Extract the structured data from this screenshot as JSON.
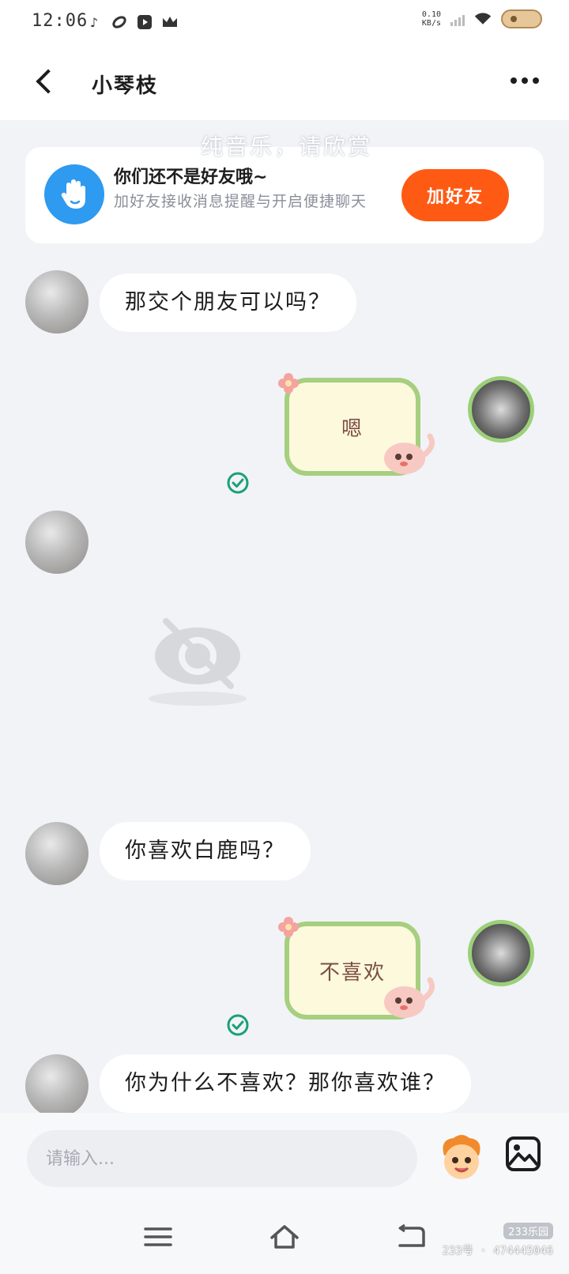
{
  "status_bar": {
    "time": "12:06",
    "net_speed_value": "0.10",
    "net_speed_unit": "KB/s"
  },
  "header": {
    "title": "小琴枝"
  },
  "watermark_top": "纯音乐，请欣赏",
  "friend_card": {
    "title": "你们还不是好友哦~",
    "subtitle": "加好友接收消息提醒与开启便捷聊天",
    "button": "加好友"
  },
  "messages": [
    {
      "side": "in",
      "type": "text",
      "text": "那交个朋友可以吗？"
    },
    {
      "side": "out",
      "type": "sticker-text",
      "text": "嗯",
      "read": true
    },
    {
      "side": "in",
      "type": "hidden-image"
    },
    {
      "side": "in",
      "type": "text",
      "text": "你喜欢白鹿吗？"
    },
    {
      "side": "out",
      "type": "sticker-text",
      "text": "不喜欢",
      "read": true
    },
    {
      "side": "in",
      "type": "text",
      "text": "你为什么不喜欢？那你喜欢谁？"
    }
  ],
  "input": {
    "placeholder": "请输入..."
  },
  "watermark_bottom": {
    "logo": "233乐园",
    "id_text": "233号 · 474445046"
  },
  "colors": {
    "accent": "#ff5a14",
    "check": "#1aa074",
    "sticker_border": "#a6cf7f",
    "sticker_fill": "#fdf9dc"
  }
}
